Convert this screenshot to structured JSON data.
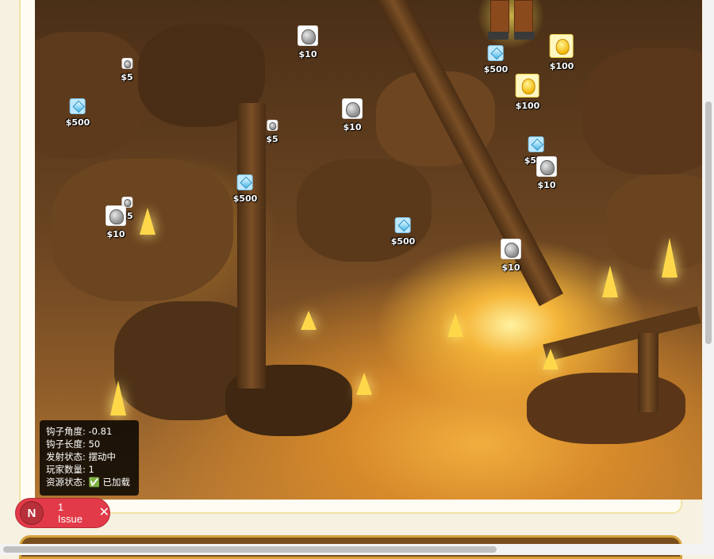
{
  "scene": {
    "items": [
      {
        "type": "rock",
        "size": "s-big",
        "value": "$10"
      },
      {
        "type": "rock",
        "size": "s-small",
        "value": "$5"
      },
      {
        "type": "diamond",
        "size": "s-med",
        "value": "$500"
      },
      {
        "type": "rock",
        "size": "s-big",
        "value": "$10"
      },
      {
        "type": "rock",
        "size": "s-small",
        "value": "$5"
      },
      {
        "type": "diamond",
        "size": "s-med",
        "value": "$500"
      },
      {
        "type": "rock",
        "size": "s-small",
        "value": "$5"
      },
      {
        "type": "rock",
        "size": "s-big",
        "value": "$10"
      },
      {
        "type": "diamond",
        "size": "s-med",
        "value": "$500"
      },
      {
        "type": "diamond",
        "size": "s-med",
        "value": "$500"
      },
      {
        "type": "gold",
        "size": "s-gold",
        "value": "$100"
      },
      {
        "type": "gold",
        "size": "s-gold",
        "value": "$100"
      },
      {
        "type": "diamond",
        "size": "s-med",
        "value": "$500"
      },
      {
        "type": "rock",
        "size": "s-big",
        "value": "$10"
      },
      {
        "type": "rock",
        "size": "s-big",
        "value": "$10"
      }
    ]
  },
  "debug": {
    "hook_angle": "钩子角度: -0.81",
    "hook_length": "钩子长度: 50",
    "fire_state": "发射状态: 摆动中",
    "player_count": "玩家数量: 1",
    "resource_state": "资源状态: ✅ 已加载"
  },
  "issue_badge": {
    "avatar_letter": "N",
    "text": "1 Issue",
    "close_glyph": "✕"
  },
  "colors": {
    "issue_red": "#e23a48",
    "panel_brown": "#7a4d1c",
    "gold_border": "#d6a23a"
  }
}
